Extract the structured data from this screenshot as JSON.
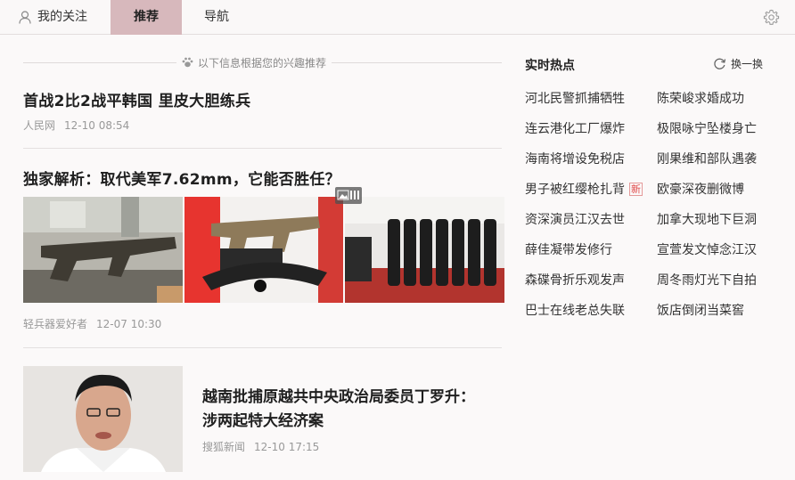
{
  "nav": {
    "follow_label": "我的关注",
    "recommend_label": "推荐",
    "navigation_label": "导航"
  },
  "hint": "以下信息根据您的兴趣推荐",
  "articles": [
    {
      "title": "首战2比2战平韩国 里皮大胆练兵",
      "source": "人民网",
      "time": "12-10 08:54"
    },
    {
      "title": "独家解析：取代美军7.62mm，它能否胜任？",
      "source": "轻兵器爱好者",
      "time": "12-07 10:30"
    },
    {
      "title_line1": "越南批捕原越共中央政治局委员丁罗升：",
      "title_line2": "涉两起特大经济案",
      "source": "搜狐新闻",
      "time": "12-10 17:15"
    }
  ],
  "hot": {
    "title": "实时热点",
    "refresh_label": "换一换",
    "new_badge": "新",
    "left": [
      "河北民警抓捕牺牲",
      "连云港化工厂爆炸",
      "海南将增设免税店",
      "男子被红缨枪扎背",
      "资深演员江汉去世",
      "薛佳凝带发修行",
      "森碟骨折乐观发声",
      "巴士在线老总失联"
    ],
    "right": [
      "陈荣峻求婚成功",
      "极限咏宁坠楼身亡",
      "刚果维和部队遇袭",
      "欧豪深夜删微博",
      "加拿大现地下巨洞",
      "宣萱发文悼念江汉",
      "周冬雨灯光下自拍",
      "饭店倒闭当菜窖"
    ]
  },
  "colors": {
    "active_tab": "#d7b8bc",
    "background": "#fbf9f9",
    "new_badge": "#e04848"
  }
}
